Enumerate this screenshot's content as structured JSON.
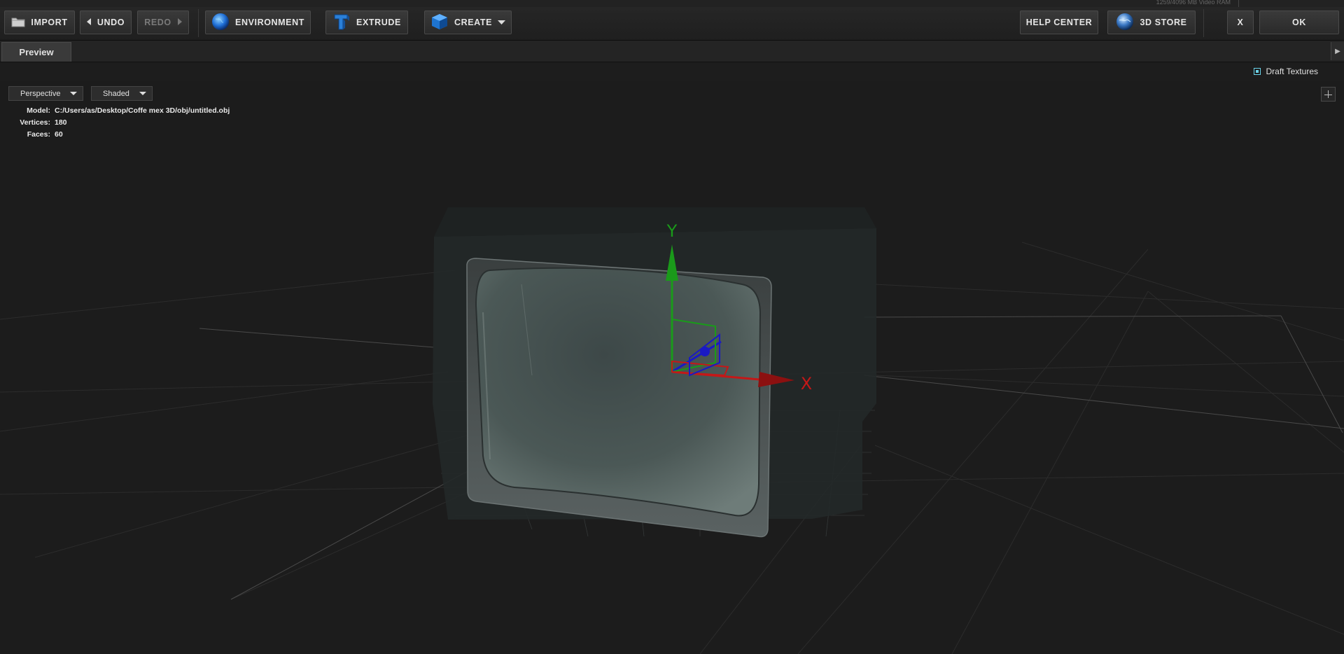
{
  "status": {
    "ram_text": "1259/4096 MB Video RAM"
  },
  "toolbar": {
    "import": "IMPORT",
    "undo": "UNDO",
    "redo": "REDO",
    "environment": "ENVIRONMENT",
    "extrude": "EXTRUDE",
    "create": "CREATE",
    "help_center": "HELP CENTER",
    "store": "3D STORE",
    "close": "X",
    "ok": "OK"
  },
  "tabs": {
    "preview": "Preview"
  },
  "options": {
    "draft_textures": "Draft Textures",
    "draft_textures_checked": true
  },
  "viewport": {
    "camera_mode": "Perspective",
    "shading_mode": "Shaded",
    "model_label": "Model:",
    "model_path": "C:/Users/as/Desktop/Coffe mex 3D/obj/untitled.obj",
    "vertices_label": "Vertices:",
    "vertices": "180",
    "faces_label": "Faces:",
    "faces": "60",
    "axis_x": "X",
    "axis_y": "Y"
  },
  "colors": {
    "axis_x": "#c41818",
    "axis_y": "#1a9a1a",
    "axis_z": "#1a1ac4",
    "accent": "#6ad2e8"
  }
}
